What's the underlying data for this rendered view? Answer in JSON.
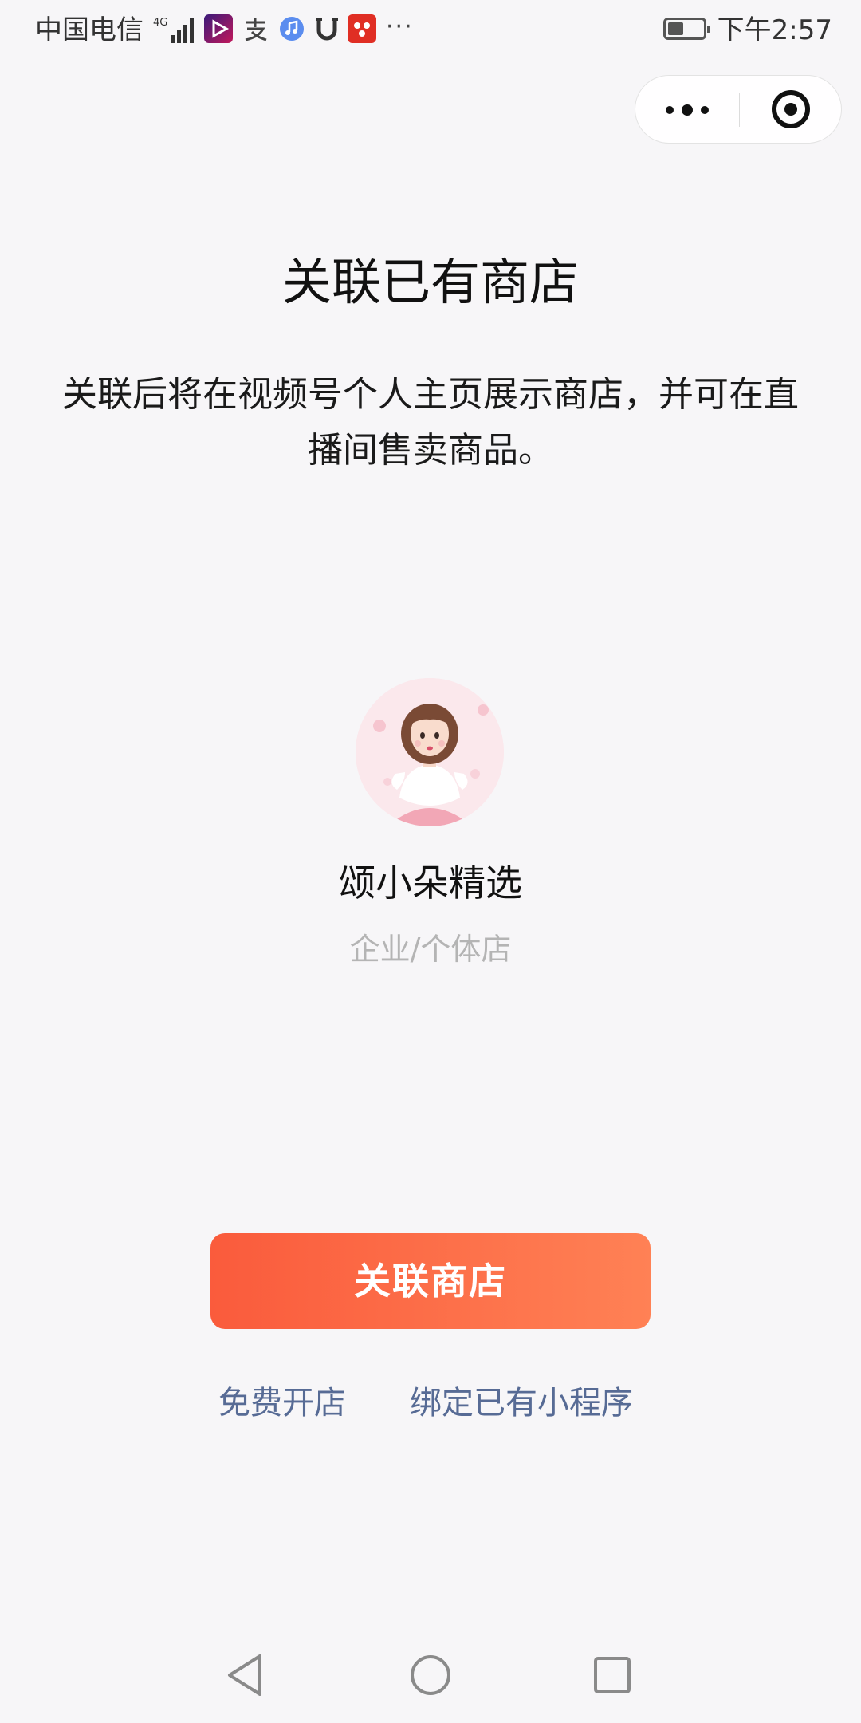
{
  "status_bar": {
    "carrier": "中国电信",
    "network": "4G",
    "more_indicator": "···",
    "time": "下午2:57",
    "battery_level": 0.45,
    "icons": [
      "signal-icon",
      "video-app-icon",
      "alipay-icon",
      "music-icon",
      "u-app-icon",
      "pinduoduo-icon",
      "battery-icon"
    ]
  },
  "capsule": {
    "icons": [
      "more-dots-icon",
      "close-target-icon"
    ]
  },
  "page": {
    "title": "关联已有商店",
    "description": "关联后将在视频号个人主页展示商店，并可在直播间售卖商品。"
  },
  "store": {
    "name": "颂小朵精选",
    "type": "企业/个体店"
  },
  "actions": {
    "primary_label": "关联商店",
    "free_open_label": "免费开店",
    "bind_mini_program_label": "绑定已有小程序"
  },
  "colors": {
    "accent_start": "#fa5b3c",
    "accent_end": "#ff8155",
    "link": "#576b95",
    "muted_text": "#b4b4b4",
    "background": "#f7f6f8"
  },
  "nav_bar": {
    "icons": [
      "back-triangle-icon",
      "home-circle-icon",
      "recent-square-icon"
    ]
  }
}
